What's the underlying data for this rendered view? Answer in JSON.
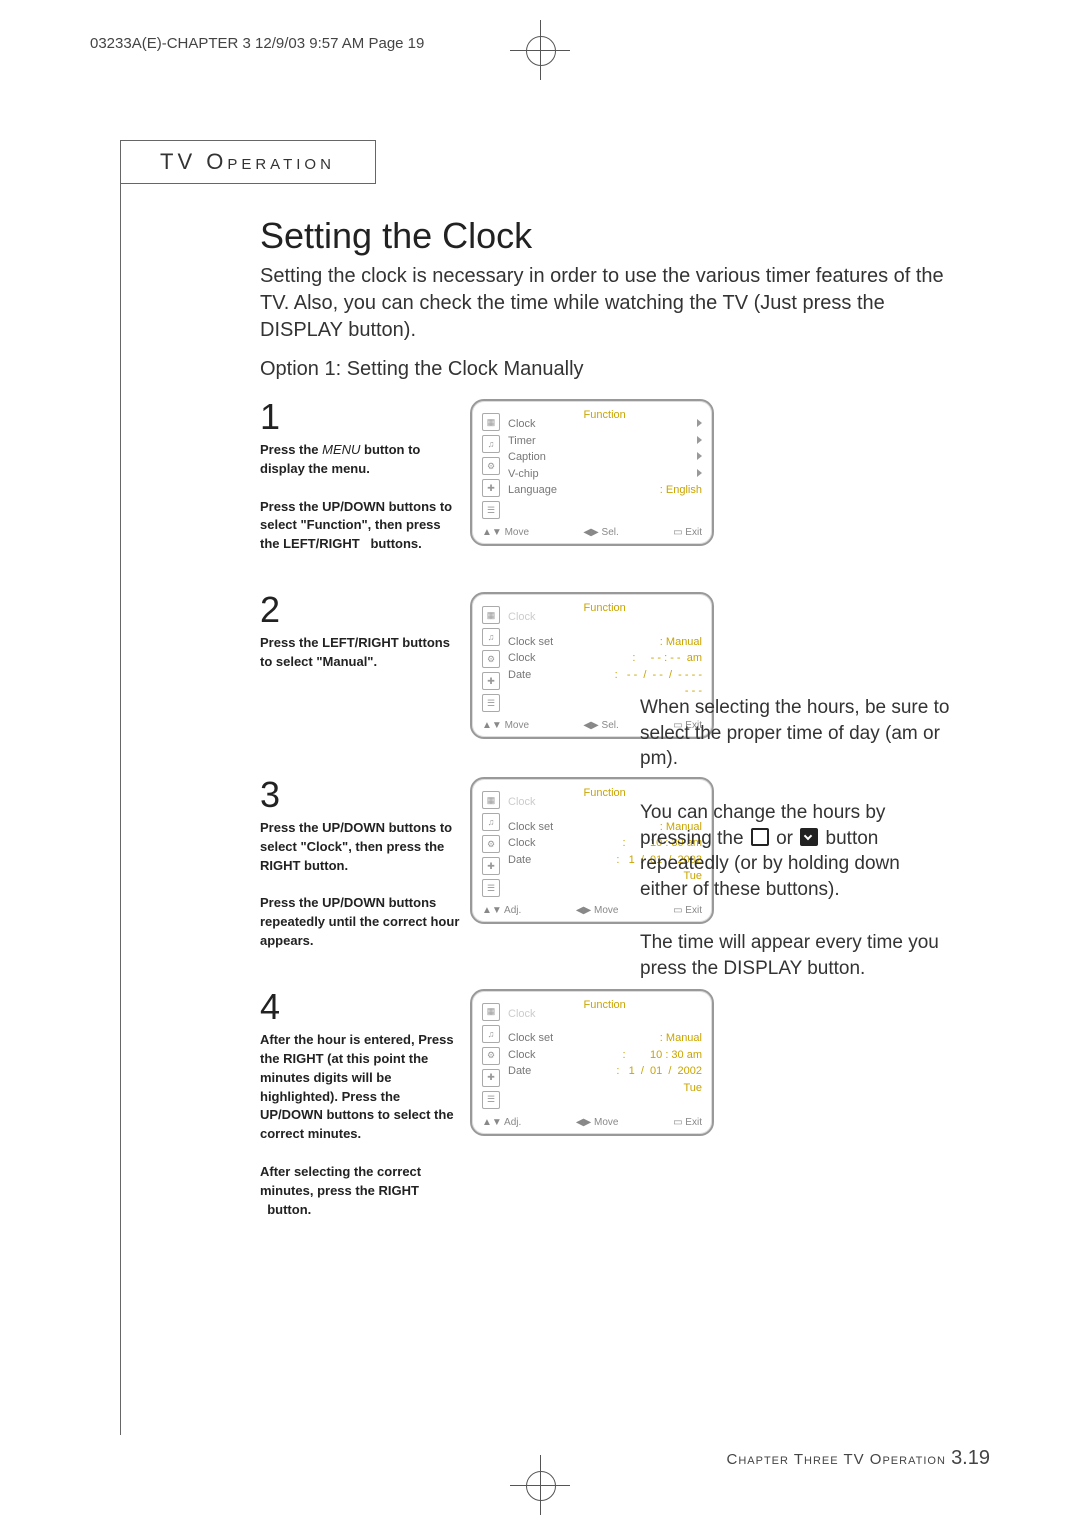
{
  "print_header": "03233A(E)-CHAPTER 3  12/9/03  9:57 AM  Page 19",
  "section_label": "TV Operation",
  "title": "Setting the Clock",
  "intro": "Setting the clock is necessary in order to use the various timer features of the TV. Also, you can check the time while watching the TV (Just press the DISPLAY button).",
  "option_line": "Option 1: Setting the Clock Manually",
  "steps": [
    {
      "num": "1",
      "text_html": "Press the <span class='menu'>MENU</span> button to display the menu.<br><br>Press the UP/DOWN buttons to select \"Function\", then press the LEFT/RIGHT   buttons.",
      "osd": {
        "title": "Function",
        "header": "",
        "rows": [
          {
            "label": "Clock",
            "val": "▶"
          },
          {
            "label": "Timer",
            "val": "▶"
          },
          {
            "label": "Caption",
            "val": "▶"
          },
          {
            "label": "V-chip",
            "val": "▶"
          },
          {
            "label": "Language",
            "val": ": English"
          }
        ],
        "foot": {
          "a": "▲▼ Move",
          "b": "◀▶ Sel.",
          "c": "▭ Exit"
        }
      }
    },
    {
      "num": "2",
      "text_html": "Press the LEFT/RIGHT buttons to select \"Manual\".",
      "osd": {
        "title": "Function",
        "header": "Clock",
        "rows": [
          {
            "label": "Clock set",
            "val": ": Manual"
          },
          {
            "label": "Clock",
            "val": ":     - - : - -  am"
          },
          {
            "label": "Date",
            "val": ":   - -  /  - -  /  - - - -"
          },
          {
            "label": "",
            "val": "- - -"
          }
        ],
        "foot": {
          "a": "▲▼ Move",
          "b": "◀▶ Sel.",
          "c": "▭ Exit"
        }
      }
    },
    {
      "num": "3",
      "text_html": "Press the UP/DOWN buttons to select \"Clock\", then press the RIGHT button.<br><br>Press the UP/DOWN buttons repeatedly until the correct hour appears.",
      "osd": {
        "title": "Function",
        "header": "Clock",
        "rows": [
          {
            "label": "Clock set",
            "val": ": Manual"
          },
          {
            "label": "Clock",
            "val": ":        10 : 30 am"
          },
          {
            "label": "Date",
            "val": ":   1  /  01  /  2002"
          },
          {
            "label": "",
            "val": "Tue"
          }
        ],
        "foot": {
          "a": "▲▼ Adj.",
          "b": "◀▶ Move",
          "c": "▭  Exit"
        }
      }
    },
    {
      "num": "4",
      "text_html": "After the hour is entered, Press the RIGHT (at this point the minutes digits will be highlighted). Press the UP/DOWN buttons to select the correct minutes.<br><br>After selecting the correct minutes, press the RIGHT   button.",
      "osd": {
        "title": "Function",
        "header": "Clock",
        "rows": [
          {
            "label": "Clock set",
            "val": ": Manual"
          },
          {
            "label": "Clock",
            "val": ":        10 : 30 am"
          },
          {
            "label": "Date",
            "val": ":   1  /  01  /  2002"
          },
          {
            "label": "",
            "val": "Tue"
          }
        ],
        "foot": {
          "a": "▲▼ Adj.",
          "b": "◀▶ Move",
          "c": "▭  Exit"
        }
      }
    }
  ],
  "notes": {
    "p1": "When selecting the hours, be sure to select the proper time of day (am or pm).",
    "p2_a": "You can change the hours by pressing the",
    "p2_b": "or",
    "p2_c": "button repeatedly (or by holding down either of these buttons).",
    "p3": "The time will appear every time you press the DISPLAY button."
  },
  "footer": {
    "chapter": "Chapter Three TV Operation",
    "page": "3.19"
  }
}
